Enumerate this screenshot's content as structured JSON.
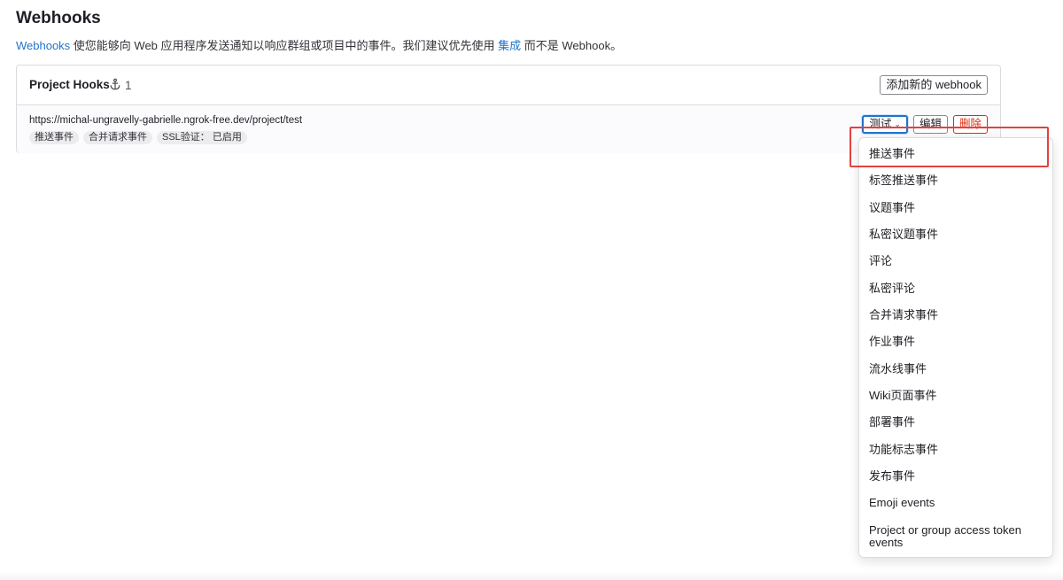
{
  "page": {
    "title": "Webhooks",
    "intro_link": "Webhooks",
    "intro_text_1": " 使您能够向 Web 应用程序发送通知以响应群组或项目中的事件。我们建议优先使用 ",
    "intro_link_2": "集成",
    "intro_text_2": " 而不是 Webhook。"
  },
  "panel": {
    "title": "Project Hooks",
    "count": "1",
    "add_button": "添加新的 webhook"
  },
  "hook": {
    "url": "https://michal-ungravelly-gabrielle.ngrok-free.dev/project/test",
    "badges": [
      "推送事件",
      "合并请求事件",
      "SSL验证：  已启用"
    ],
    "test_button": "测试",
    "edit_button": "编辑",
    "delete_button": "删除"
  },
  "dropdown": {
    "items": [
      "推送事件",
      "标签推送事件",
      "议题事件",
      "私密议题事件",
      "评论",
      "私密评论",
      "合并请求事件",
      "作业事件",
      "流水线事件",
      "Wiki页面事件",
      "部署事件",
      "功能标志事件",
      "发布事件",
      "Emoji events",
      "Project or group access token events"
    ]
  },
  "colors": {
    "link": "#1f75cb",
    "danger": "#dd2b0e",
    "highlight": "#e2423f"
  },
  "icons": {
    "hook": "anchor-icon",
    "chevron": "chevron-down-icon"
  }
}
